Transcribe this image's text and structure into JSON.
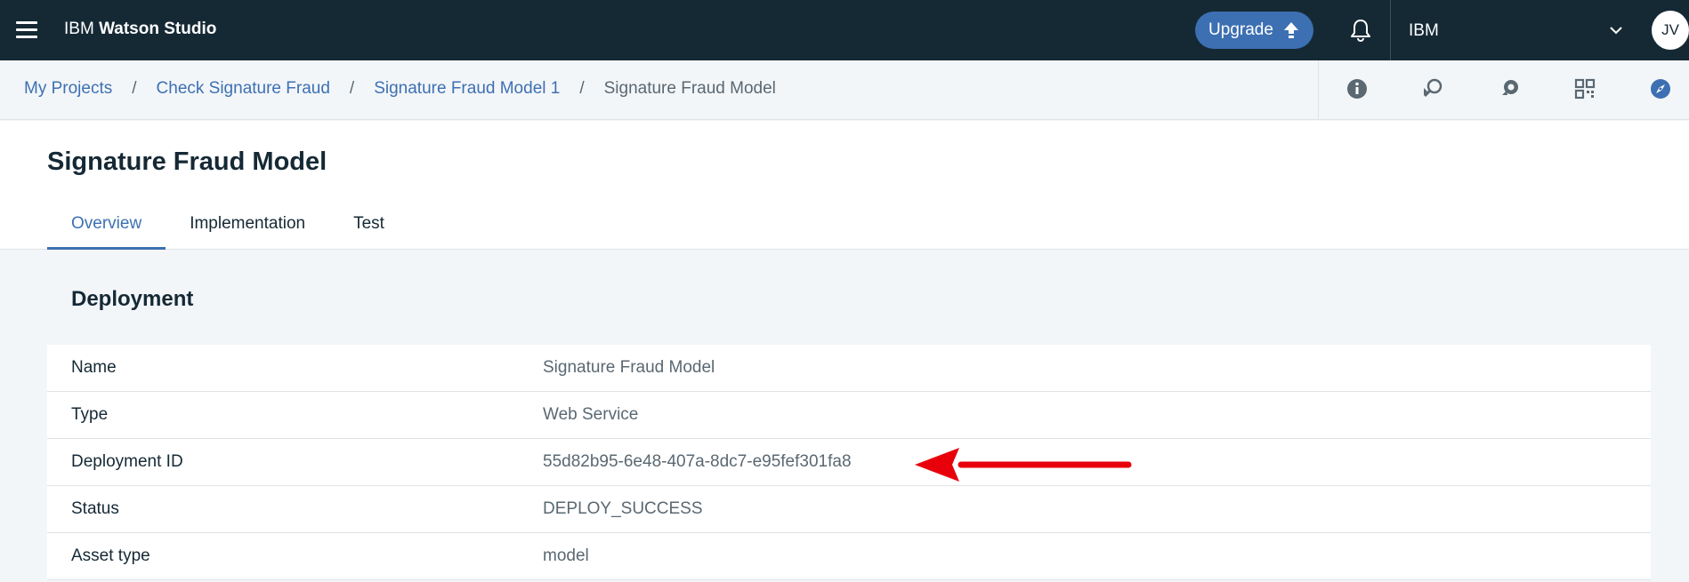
{
  "topbar": {
    "brand_prefix": "IBM",
    "brand_name": "Watson Studio",
    "upgrade_label": "Upgrade",
    "account_name": "IBM",
    "avatar_initials": "JV",
    "icons": [
      "menu-icon",
      "arrow-up-icon",
      "bell-icon",
      "chevron-down-icon"
    ]
  },
  "breadcrumb": {
    "items": [
      "My Projects",
      "Check Signature Fraud",
      "Signature Fraud Model 1"
    ],
    "separator": "/",
    "current": "Signature Fraud Model",
    "tool_icons": [
      "info-icon",
      "find-data-icon",
      "chat-icon",
      "grid-icon",
      "compass-icon"
    ]
  },
  "page": {
    "title": "Signature Fraud Model",
    "tabs": [
      "Overview",
      "Implementation",
      "Test"
    ],
    "active_tab": "Overview"
  },
  "deployment": {
    "section_title": "Deployment",
    "rows": [
      {
        "key": "Name",
        "value": "Signature Fraud Model"
      },
      {
        "key": "Type",
        "value": "Web Service"
      },
      {
        "key": "Deployment ID",
        "value": "55d82b95-6e48-407a-8dc7-e95fef301fa8"
      },
      {
        "key": "Status",
        "value": "DEPLOY_SUCCESS"
      },
      {
        "key": "Asset type",
        "value": "model"
      }
    ]
  },
  "annotation": {
    "arrow_color": "#e8000b"
  },
  "colors": {
    "topbar_bg": "#152935",
    "accent": "#3d70b2",
    "page_bg": "#f3f6f9"
  }
}
